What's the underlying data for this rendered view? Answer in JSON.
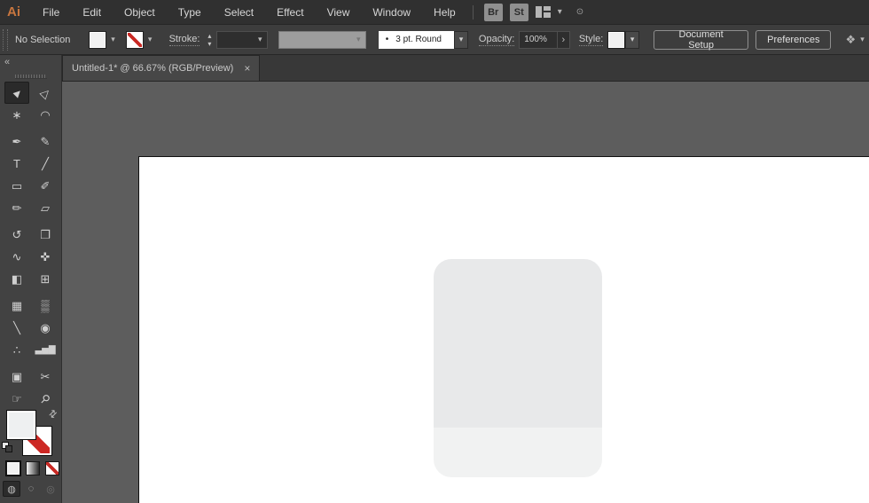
{
  "menu_bar": {
    "logo": "Ai",
    "items": [
      "File",
      "Edit",
      "Object",
      "Type",
      "Select",
      "Effect",
      "View",
      "Window",
      "Help"
    ],
    "bridge_label": "Br",
    "stock_label": "St"
  },
  "control_bar": {
    "selection_status": "No Selection",
    "stroke_label": "Stroke:",
    "brush_bullet": "•",
    "brush_value": "3 pt. Round",
    "opacity_label": "Opacity:",
    "opacity_value": "100%",
    "opacity_arrow": "›",
    "style_label": "Style:",
    "document_setup_label": "Document Setup",
    "preferences_label": "Preferences"
  },
  "tab_bar": {
    "tabs": [
      {
        "title": "Untitled-1* @ 66.67% (RGB/Preview)",
        "document": "Untitled-1*",
        "zoom": "66.67%",
        "mode": "RGB/Preview",
        "active": true
      }
    ]
  },
  "icons": {
    "chevron_down": "▾",
    "step_up": "▴",
    "step_down": "▾",
    "collapse": "«",
    "swap": "⇄",
    "close": "×",
    "select_similar": "❖",
    "gpu": "⊙"
  },
  "tools": {
    "items": [
      {
        "name": "selection-tool",
        "glyph": "►",
        "selected": true
      },
      {
        "name": "direct-selection-tool",
        "glyph": "▷"
      },
      {
        "name": "magic-wand-tool",
        "glyph": "∗"
      },
      {
        "name": "lasso-tool",
        "glyph": "◠"
      },
      {
        "name": "pen-tool",
        "glyph": "✒"
      },
      {
        "name": "curvature-tool",
        "glyph": "✎"
      },
      {
        "name": "type-tool",
        "glyph": "T"
      },
      {
        "name": "line-segment-tool",
        "glyph": "╱"
      },
      {
        "name": "rectangle-tool",
        "glyph": "▭"
      },
      {
        "name": "paintbrush-tool",
        "glyph": "✐"
      },
      {
        "name": "shaper-tool",
        "glyph": "✏"
      },
      {
        "name": "eraser-tool",
        "glyph": "▱"
      },
      {
        "name": "rotate-tool",
        "glyph": "↺"
      },
      {
        "name": "scale-tool",
        "glyph": "❐"
      },
      {
        "name": "width-tool",
        "glyph": "∿"
      },
      {
        "name": "puppet-warp-tool",
        "glyph": "✜"
      },
      {
        "name": "shape-builder-tool",
        "glyph": "◧"
      },
      {
        "name": "perspective-grid-tool",
        "glyph": "⊞"
      },
      {
        "name": "mesh-tool",
        "glyph": "▦"
      },
      {
        "name": "gradient-tool",
        "glyph": "▒"
      },
      {
        "name": "eyedropper-tool",
        "glyph": "╲"
      },
      {
        "name": "blend-tool",
        "glyph": "◉"
      },
      {
        "name": "symbol-sprayer-tool",
        "glyph": "∴"
      },
      {
        "name": "column-graph-tool",
        "glyph": "▃▅▇"
      },
      {
        "name": "artboard-tool",
        "glyph": "▣"
      },
      {
        "name": "slice-tool",
        "glyph": "✂"
      },
      {
        "name": "hand-tool",
        "glyph": "☞"
      },
      {
        "name": "zoom-tool",
        "glyph": "⚲"
      }
    ],
    "drawing_modes": [
      {
        "name": "draw-normal",
        "glyph": "◍"
      },
      {
        "name": "draw-behind",
        "glyph": "◌"
      },
      {
        "name": "draw-inside",
        "glyph": "◎"
      }
    ]
  },
  "canvas": {
    "pasteboard_color": "#5d5d5d",
    "artboard_color": "#ffffff",
    "shape_top_color": "#e8e9ea",
    "shape_bottom_color": "#f1f2f2"
  },
  "colors": {
    "menubar_bg": "#303030",
    "controlbar_bg": "#3d3d3d",
    "panel_bg": "#424242",
    "logo_orange": "#c8763f",
    "none_red": "#c92a25"
  }
}
